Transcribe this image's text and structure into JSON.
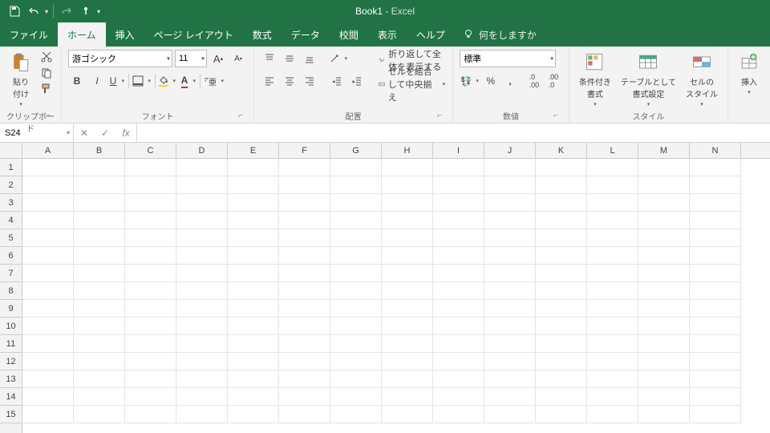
{
  "title": {
    "doc": "Book1",
    "sep": " - ",
    "app": "Excel"
  },
  "tabs": [
    "ファイル",
    "ホーム",
    "挿入",
    "ページ レイアウト",
    "数式",
    "データ",
    "校閲",
    "表示",
    "ヘルプ"
  ],
  "active_tab": 1,
  "tell_me": "何をしますか",
  "clipboard": {
    "paste": "貼り付け",
    "label": "クリップボード"
  },
  "font": {
    "name": "游ゴシック",
    "size": "11",
    "bold": "B",
    "italic": "I",
    "underline": "U",
    "label": "フォント"
  },
  "align": {
    "wrap": "折り返して全体を表示する",
    "merge": "セルを結合して中央揃え",
    "label": "配置"
  },
  "number": {
    "format": "標準",
    "label": "数値"
  },
  "styles": {
    "cond": "条件付き\n書式",
    "table": "テーブルとして\n書式設定",
    "cell": "セルの\nスタイル",
    "label": "スタイル"
  },
  "cells_grp": {
    "insert": "挿入"
  },
  "namebox": "S24",
  "columns": [
    "A",
    "B",
    "C",
    "D",
    "E",
    "F",
    "G",
    "H",
    "I",
    "J",
    "K",
    "L",
    "M",
    "N"
  ],
  "rows": [
    "1",
    "2",
    "3",
    "4",
    "5",
    "6",
    "7",
    "8",
    "9",
    "10",
    "11",
    "12",
    "13",
    "14",
    "15"
  ]
}
